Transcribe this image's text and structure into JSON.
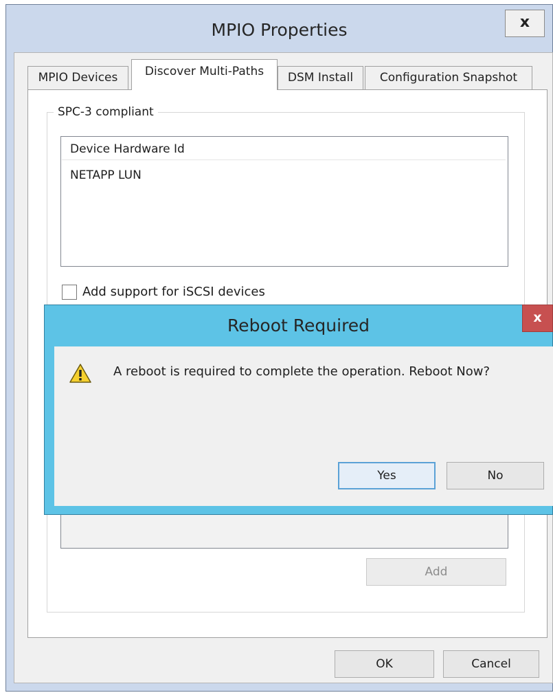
{
  "window": {
    "title": "MPIO Properties",
    "close_label": "x"
  },
  "tabs": [
    {
      "label": "MPIO Devices",
      "selected": false
    },
    {
      "label": "Discover Multi-Paths",
      "selected": true
    },
    {
      "label": "DSM Install",
      "selected": false
    },
    {
      "label": "Configuration Snapshot",
      "selected": false
    }
  ],
  "spc3_group": {
    "legend": "SPC-3 compliant",
    "column_header": "Device Hardware Id",
    "items": [
      "NETAPP  LUN"
    ],
    "iscsi_checkbox_label": "Add support for iSCSI devices",
    "iscsi_checked": false,
    "add_button": "Add"
  },
  "footer": {
    "ok_button": "OK",
    "cancel_button": "Cancel"
  },
  "dialog": {
    "title": "Reboot Required",
    "close_label": "x",
    "icon": "warning-icon",
    "message": "A reboot is required to complete the operation. Reboot Now?",
    "yes_button": "Yes",
    "no_button": "No"
  },
  "colors": {
    "window_frame": "#cbd8ec",
    "dialog_frame": "#5dc3e6",
    "dialog_close": "#c75050"
  }
}
